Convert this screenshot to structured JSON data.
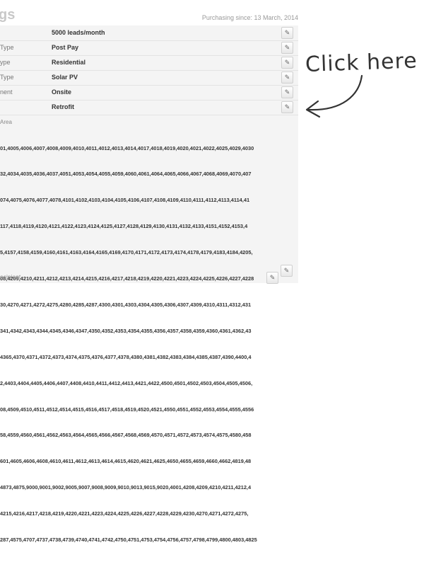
{
  "header": {
    "heading": "gs",
    "purchasing_since": "Purchasing since: 13 March, 2014"
  },
  "rows": [
    {
      "label": "",
      "value": "5000 leads/month"
    },
    {
      "label": "Type",
      "value": "Post Pay"
    },
    {
      "label": "ype",
      "value": "Residential"
    },
    {
      "label": "Type",
      "value": "Solar PV"
    },
    {
      "label": "nent",
      "value": "Onsite"
    },
    {
      "label": "",
      "value": "Retrofit"
    }
  ],
  "area": {
    "label": "Area",
    "lines": [
      "01,4005,4006,4007,4008,4009,4010,4011,4012,4013,4014,4017,4018,4019,4020,4021,4022,4025,4029,4030",
      "32,4034,4035,4036,4037,4051,4053,4054,4055,4059,4060,4061,4064,4065,4066,4067,4068,4069,4070,407",
      "074,4075,4076,4077,4078,4101,4102,4103,4104,4105,4106,4107,4108,4109,4110,4111,4112,4113,4114,41",
      "117,4118,4119,4120,4121,4122,4123,4124,4125,4127,4128,4129,4130,4131,4132,4133,4151,4152,4153,4",
      "5,4157,4158,4159,4160,4161,4163,4164,4165,4169,4170,4171,4172,4173,4174,4178,4179,4183,4184,4205,",
      "08,4209,4210,4211,4212,4213,4214,4215,4216,4217,4218,4219,4220,4221,4223,4224,4225,4226,4227,4228",
      "30,4270,4271,4272,4275,4280,4285,4287,4300,4301,4303,4304,4305,4306,4307,4309,4310,4311,4312,431",
      "341,4342,4343,4344,4345,4346,4347,4350,4352,4353,4354,4355,4356,4357,4358,4359,4360,4361,4362,43",
      "4365,4370,4371,4372,4373,4374,4375,4376,4377,4378,4380,4381,4382,4383,4384,4385,4387,4390,4400,4",
      "2,4403,4404,4405,4406,4407,4408,4410,4411,4412,4413,4421,4422,4500,4501,4502,4503,4504,4505,4506,",
      "08,4509,4510,4511,4512,4514,4515,4516,4517,4518,4519,4520,4521,4550,4551,4552,4553,4554,4555,4556",
      "58,4559,4560,4561,4562,4563,4564,4565,4566,4567,4568,4569,4570,4571,4572,4573,4574,4575,4580,458",
      "601,4605,4606,4608,4610,4611,4612,4613,4614,4615,4620,4621,4625,4650,4655,4659,4660,4662,4819,48",
      "4873,4875,9000,9001,9002,9005,9007,9008,9009,9010,9013,9015,9020,4001,4208,4209,4210,4211,4212,4",
      "4215,4216,4217,4218,4219,4220,4221,4223,4224,4225,4226,4227,4228,4229,4230,4270,4271,4272,4275,",
      "287,4575,4707,4737,4738,4739,4740,4741,4742,4750,4751,4753,4754,4756,4757,4798,4799,4800,4803,4825"
    ]
  },
  "recipient": {
    "label": "ecipient"
  },
  "callout": {
    "text": "Click here to e"
  },
  "icons": {
    "edit": "pencil-icon",
    "arrow": "curved-arrow"
  },
  "colors": {
    "panel": "#f4f4f4",
    "heading": "#c8c8c8",
    "text": "#333333"
  }
}
